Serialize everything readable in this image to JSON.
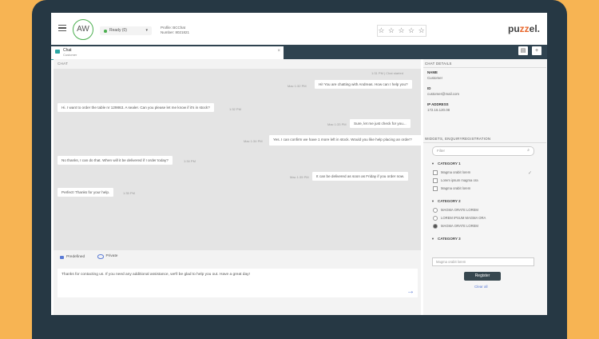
{
  "header": {
    "avatar_initials": "AW",
    "status": "Ready (0)",
    "profile_line1": "Profile: BCChat",
    "profile_line2": "Number: 8021821",
    "rating_stars": "☆ ☆ ☆ ☆ ☆",
    "logo_prefix": "pu",
    "logo_mid": "zz",
    "logo_suffix": "el."
  },
  "chat_tab": {
    "title": "Chat",
    "subtitle": "Customer",
    "close": "×"
  },
  "chat": {
    "section_label": "CHAT",
    "header_timestamp": "1:31 PM | Chat started",
    "messages": [
      {
        "side": "agent",
        "text": "Hi! You are chatting with Andreas. How can I help you?",
        "ts": "Mac 1:32 PM"
      },
      {
        "side": "customer",
        "text": "Hi. I want to order the table nr 129863. A sealer. Can you please let me know if it's in stock?",
        "ts": "1:32 PM"
      },
      {
        "side": "agent",
        "text": "Sure, let me just check for you...",
        "ts": "Mac 1:33 PM"
      },
      {
        "side": "agent",
        "text": "Yes. I can confirm we have 1 more left in stock. Would you like help placing an order?",
        "ts": "Mac 1:34 PM"
      },
      {
        "side": "customer",
        "text": "No thanks, I can do that. When will it be delivered if I order today?",
        "ts": "1:34 PM"
      },
      {
        "side": "agent",
        "text": "It can be delivered as soon as Friday if you order now.",
        "ts": "Mac 1:35 PM"
      },
      {
        "side": "customer",
        "text": "Perfect! Thanks for your help.",
        "ts": "1:35 PM"
      }
    ]
  },
  "composer": {
    "tab_predefined": "Predefined",
    "tab_private": "Private",
    "draft_text": "Thanks for contacting us. If you need any additional assistance, we'll be glad to help you out. Have a great day!",
    "send_icon": "→"
  },
  "details": {
    "section_label": "CHAT DETAILS",
    "name_label": "NAME",
    "name_value": "Customer",
    "id_label": "ID",
    "id_value": "customer@mail.com",
    "ip_label": "IP ADDRESS",
    "ip_value": "172.16.120.08"
  },
  "widgets": {
    "section_label": "WIDGETS, ENQUIRYREGISTRATION",
    "filter_placeholder": "Filter",
    "category1": "CATEGORY 1",
    "cat1_options": [
      "Magma orabit lorem",
      "Lorem ipsum magma ora",
      "Magma orabit lorem"
    ],
    "category2": "CATEGORY 2",
    "cat2_options": [
      "MAGMA ORATE LOREM",
      "LOREM IPSUM MAGMA ORA",
      "MAGMA ORATE LOREM"
    ],
    "category3": "CATEGORY 3",
    "cat3_placeholder": "Magma orabit lorem",
    "register_label": "Register",
    "clear_label": "Clear all"
  }
}
